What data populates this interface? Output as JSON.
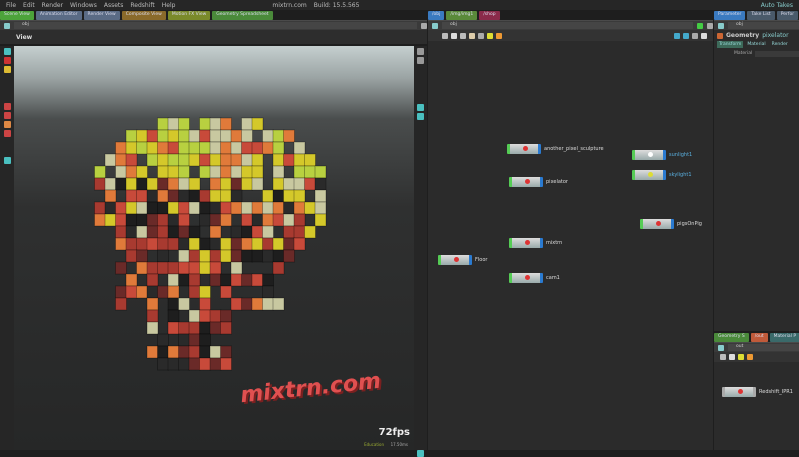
{
  "menu": {
    "items": [
      "File",
      "Edit",
      "Render",
      "Windows",
      "Assets",
      "Redshift",
      "Help"
    ],
    "title": "mixtrn.com",
    "build": "Build: 15.5.565"
  },
  "left_pane": {
    "tabs": [
      {
        "label": "Scene View",
        "color": "#4ca33a"
      },
      {
        "label": "Animation Editor",
        "color": "#5a6b85"
      },
      {
        "label": "Render View",
        "color": "#5a6b85"
      },
      {
        "label": "Composite View",
        "color": "#8a6a2a"
      },
      {
        "label": "Motion FX View",
        "color": "#7a8a2a"
      },
      {
        "label": "Geometry Spreadsheet",
        "color": "#4a8a3a"
      }
    ],
    "path": "obj",
    "view_label": "View",
    "watermark": "mixtrn.com",
    "fps": "72fps",
    "fps_sub": "17.50ms",
    "edu_label": "Education"
  },
  "network_pane": {
    "tabs": [
      {
        "label": "/obj",
        "color": "#3a7ac0"
      },
      {
        "label": "/img/img1",
        "color": "#5a8a3a"
      },
      {
        "label": "/shop",
        "color": "#8a2a4a"
      }
    ],
    "path": "obj",
    "nodes": [
      {
        "label": "another_pixel_sculpture",
        "blue": false
      },
      {
        "label": "pixelator",
        "blue": false
      },
      {
        "label": "sunlight1",
        "blue": true
      },
      {
        "label": "skylight1",
        "blue": true
      },
      {
        "label": "pigsOnPig",
        "blue": false
      },
      {
        "label": "mixtrn",
        "blue": false
      },
      {
        "label": "Floor",
        "blue": false
      },
      {
        "label": "cam1",
        "blue": false
      }
    ]
  },
  "right_pane": {
    "auto_takes": "Auto Takes",
    "tabs": [
      "Parameter",
      "Take List",
      "Perfor"
    ],
    "path": "obj",
    "geo_type": "Geometry",
    "geo_name": "pixelator",
    "param_tabs": [
      "Transform",
      "Material",
      "Render"
    ],
    "material_label": "Material",
    "lower_tabs": [
      "Geometry S",
      "/out",
      "Material P"
    ],
    "lower_path": "out",
    "lower_node": "Redshift_IPR1"
  }
}
